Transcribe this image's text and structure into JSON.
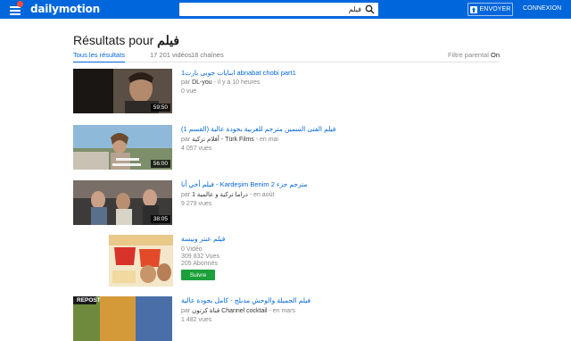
{
  "header": {
    "logo_text": "dailymotion",
    "search_value": "فيلم",
    "upload_label": "ENVOYER",
    "login_label": "CONNEXION"
  },
  "page": {
    "title_prefix": "Résultats pour",
    "title_query": "فيلم"
  },
  "tabs": [
    {
      "label": "Tous les résultats",
      "active": true
    },
    {
      "label": "17 201 vidéos",
      "active": false
    },
    {
      "label": "18 chaînes",
      "active": false
    }
  ],
  "parental": {
    "label": "Filtre parental",
    "state": "On"
  },
  "results": [
    {
      "title": "ابنابات جوبى بارت1 abnabat chobi part1",
      "by": "par",
      "author": "DL-you",
      "when": "- il y a 10 heures",
      "views": "0 vue",
      "duration": "59:50"
    },
    {
      "title": "فيلم الفتى السمين مترجم للعربية بجودة عالية (القسم 1)",
      "by": "par",
      "author": "أفلام تركية - Türk Films",
      "when": "- en mai",
      "views": "4 057 vues",
      "duration": "56:00"
    },
    {
      "title": "فيلم أخي أنا - Kardeşim Benim مترجم جزء 2",
      "by": "par",
      "author": "دراما تركية و عالمية 1",
      "when": "- en août",
      "views": "9 279 vues",
      "duration": "38:05"
    },
    {
      "title": "فيلم عنتر وبيسة",
      "videos": "0 Vidéo",
      "views": "309 832 Vues",
      "subscribers": "205 Abonnés",
      "follow_label": "Suivre"
    },
    {
      "title": "فيلم الجميلة والوحش مدبلج - كامل بجودة عالية",
      "by": "par",
      "author": "قناة كرتون Channel cocktail",
      "when": "- en mars",
      "views": "1 482 vues",
      "thumb_text": "REPOST"
    }
  ]
}
